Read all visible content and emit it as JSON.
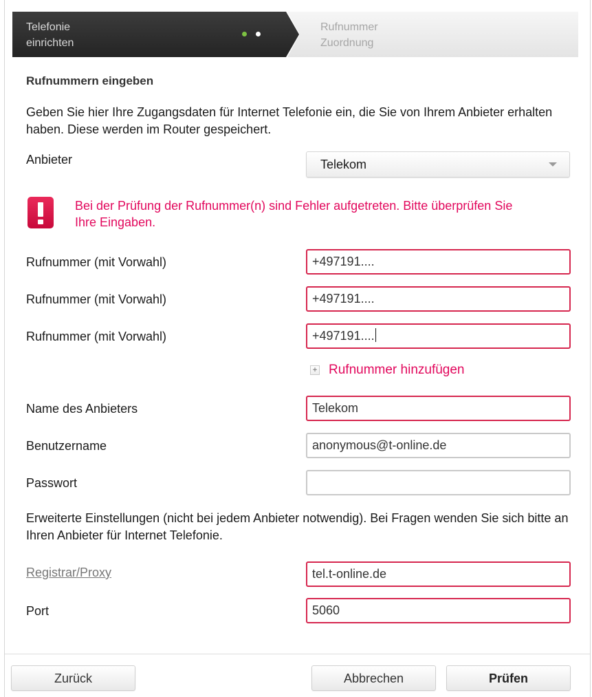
{
  "wizard": {
    "step1_line1": "Telefonie",
    "step1_line2": "einrichten",
    "step2_line1": "Rufnummer",
    "step2_line2": "Zuordnung",
    "progress_active_color": "#7dc242"
  },
  "heading": "Rufnummern eingeben",
  "intro": "Geben Sie hier Ihre Zugangsdaten für Internet Telefonie ein, die Sie von Ihrem Anbieter erhalten haben. Diese werden im Router gespeichert.",
  "provider": {
    "label": "Anbieter",
    "selected": "Telekom",
    "icon": "chevron-down-icon"
  },
  "error": {
    "icon": "exclamation-icon",
    "message": "Bei der Prüfung der Rufnummer(n) sind Fehler aufgetreten. Bitte überprüfen Sie Ihre Eingaben.",
    "color": "#e2075c"
  },
  "numbers": [
    {
      "label": "Rufnummer (mit Vorwahl)",
      "value": "+497191...."
    },
    {
      "label": "Rufnummer (mit Vorwahl)",
      "value": "+497191...."
    },
    {
      "label": "Rufnummer (mit Vorwahl)",
      "value": "+497191...."
    }
  ],
  "add_number": {
    "label": "Rufnummer hinzufügen",
    "icon": "plus-icon"
  },
  "provider_name": {
    "label": "Name des Anbieters",
    "value": "Telekom"
  },
  "username": {
    "label": "Benutzername",
    "value": "anonymous@t-online.de"
  },
  "password": {
    "label": "Passwort",
    "value": ""
  },
  "advanced_text": "Erweiterte Einstellungen (nicht bei jedem Anbieter notwendig). Bei Fragen wenden Sie sich bitte an Ihren Anbieter für Internet Telefonie.",
  "registrar": {
    "label": "Registrar/Proxy",
    "value": "tel.t-online.de"
  },
  "port": {
    "label": "Port",
    "value": "5060"
  },
  "buttons": {
    "back": "Zurück",
    "cancel": "Abbrechen",
    "check": "Prüfen"
  }
}
